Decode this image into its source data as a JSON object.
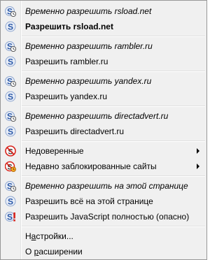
{
  "menu": {
    "groups": [
      {
        "temp": "Временно разрешить rsload.net",
        "allow": "Разрешить rsload.net"
      },
      {
        "temp": "Временно разрешить rambler.ru",
        "allow": "Разрешить rambler.ru"
      },
      {
        "temp": "Временно разрешить yandex.ru",
        "allow": "Разрешить yandex.ru"
      },
      {
        "temp": "Временно разрешить directadvert.ru",
        "allow": "Разрешить directadvert.ru"
      }
    ],
    "untrusted": "Недоверенные",
    "recently_blocked": "Недавно заблокированные сайты",
    "temp_allow_page": "Временно разрешить на этой странице",
    "allow_all_page": "Разрешить всё на этой странице",
    "allow_js_global": "Разрешить JavaScript полностью (опасно)",
    "settings_prefix": "Н",
    "settings_underlined": "а",
    "settings_suffix": "стройки...",
    "about_prefix": "О ",
    "about_underlined": "р",
    "about_suffix": "асширении"
  },
  "icons": {
    "temp_allow": "noscript-s-clock-icon",
    "allow": "noscript-s-icon",
    "untrusted": "noscript-untrusted-icon",
    "recently_blocked": "noscript-recent-blocked-icon",
    "allow_global": "noscript-s-exclamation-icon"
  },
  "colors": {
    "s_blue": "#2a58a8",
    "untrusted_red": "#d8231b"
  }
}
